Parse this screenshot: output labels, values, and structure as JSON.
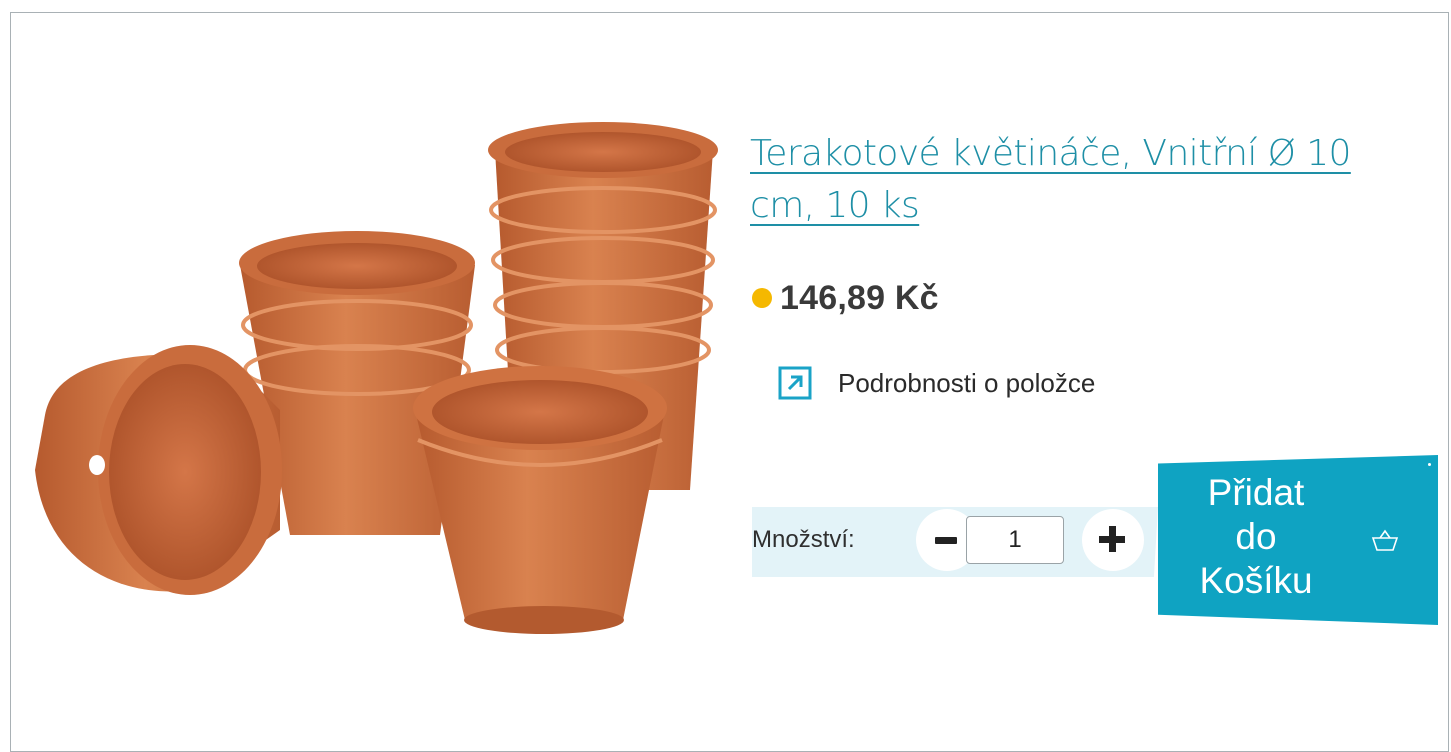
{
  "product": {
    "title": "Terakotové květináče, Vnitřní Ø 10 cm, 10 ks",
    "price": "146,89 Kč",
    "image_alt": "terracotta-pots-image"
  },
  "details": {
    "label": "Podrobnosti o položce",
    "icon": "external-link-icon"
  },
  "quantity": {
    "label": "Množství:",
    "value": "1",
    "minus_icon": "minus-icon",
    "plus_icon": "plus-icon"
  },
  "cart_button": {
    "label_line1": "Přidat",
    "label_line2": "do",
    "label_line3": "Košíku",
    "icon": "basket-icon"
  },
  "colors": {
    "accent": "#0fa3c2",
    "link": "#1e8fa6",
    "stock_dot": "#f5b800",
    "qty_panel": "#e3f3f8",
    "terracotta": "#c86a3c"
  }
}
